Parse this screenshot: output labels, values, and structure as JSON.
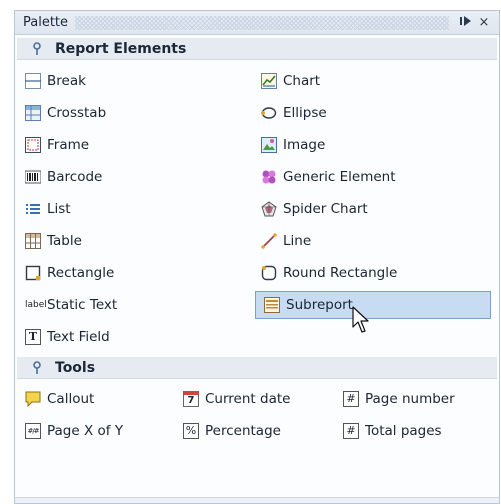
{
  "window": {
    "title": "Palette",
    "pin_icon": "pin-icon",
    "close_icon": "close-icon",
    "close_glyph": "×"
  },
  "sections": [
    {
      "title": "Report Elements",
      "icon": "category-pin-icon",
      "items": [
        {
          "label": "Break",
          "icon": "break-icon"
        },
        {
          "label": "Chart",
          "icon": "chart-icon"
        },
        {
          "label": "Crosstab",
          "icon": "crosstab-icon"
        },
        {
          "label": "Ellipse",
          "icon": "ellipse-icon"
        },
        {
          "label": "Frame",
          "icon": "frame-icon"
        },
        {
          "label": "Image",
          "icon": "image-icon"
        },
        {
          "label": "Barcode",
          "icon": "barcode-icon"
        },
        {
          "label": "Generic Element",
          "icon": "generic-element-icon"
        },
        {
          "label": "List",
          "icon": "list-icon"
        },
        {
          "label": "Spider Chart",
          "icon": "spider-chart-icon"
        },
        {
          "label": "Table",
          "icon": "table-icon"
        },
        {
          "label": "Line",
          "icon": "line-icon"
        },
        {
          "label": "Rectangle",
          "icon": "rectangle-icon"
        },
        {
          "label": "Round Rectangle",
          "icon": "round-rectangle-icon"
        },
        {
          "label": "Static Text",
          "icon": "static-text-icon",
          "icon_text": "label"
        },
        {
          "label": "Subreport",
          "icon": "subreport-icon",
          "selected": true
        },
        {
          "label": "Text Field",
          "icon": "text-field-icon",
          "icon_text": "T"
        }
      ]
    },
    {
      "title": "Tools",
      "icon": "category-pin-icon",
      "items": [
        {
          "label": "Callout",
          "icon": "callout-icon"
        },
        {
          "label": "Current date",
          "icon": "current-date-icon",
          "icon_text": "7"
        },
        {
          "label": "Page number",
          "icon": "page-number-icon",
          "icon_text": "#"
        },
        {
          "label": "Page X of Y",
          "icon": "page-x-of-y-icon",
          "icon_text": "#/#"
        },
        {
          "label": "Percentage",
          "icon": "percentage-icon",
          "icon_text": "%"
        },
        {
          "label": "Total pages",
          "icon": "total-pages-icon",
          "icon_text": "#"
        }
      ]
    }
  ],
  "colors": {
    "selected_bg": "#c7dcf2",
    "selected_border": "#7d9fc7",
    "category_bg": "#e6ebf1"
  },
  "cursor": "mouse-pointer-icon"
}
